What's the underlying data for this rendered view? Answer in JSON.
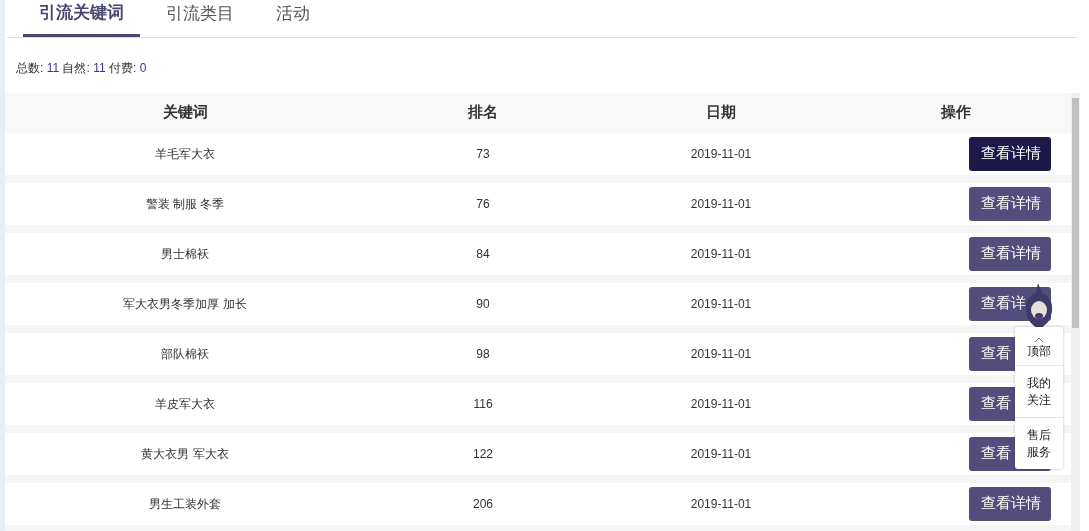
{
  "tabs": [
    {
      "label": "引流关键词",
      "selected": true
    },
    {
      "label": "引流类目",
      "selected": false
    },
    {
      "label": "活动",
      "selected": false
    }
  ],
  "summary": [
    {
      "label": "总数: ",
      "value": "11"
    },
    {
      "label": " 自然: ",
      "value": "11"
    },
    {
      "label": " 付费: ",
      "value": "0"
    }
  ],
  "table": {
    "columns": [
      "关键词",
      "排名",
      "日期",
      "操作"
    ],
    "rows": [
      {
        "keyword": "羊毛军大衣",
        "rank": "73",
        "date": "2019-11-01",
        "button": "查看详情",
        "selected": true
      },
      {
        "keyword": "警装 制服 冬季",
        "rank": "76",
        "date": "2019-11-01",
        "button": "查看详情",
        "selected": false
      },
      {
        "keyword": "男士棉袄",
        "rank": "84",
        "date": "2019-11-01",
        "button": "查看详情",
        "selected": false
      },
      {
        "keyword": "军大衣男冬季加厚 加长",
        "rank": "90",
        "date": "2019-11-01",
        "button": "查看详",
        "selected": false
      },
      {
        "keyword": "部队棉袄",
        "rank": "98",
        "date": "2019-11-01",
        "button": "查看",
        "selected": false
      },
      {
        "keyword": "羊皮军大衣",
        "rank": "116",
        "date": "2019-11-01",
        "button": "查看",
        "selected": false
      },
      {
        "keyword": "黄大衣男 军大衣",
        "rank": "122",
        "date": "2019-11-01",
        "button": "查看",
        "selected": false
      },
      {
        "keyword": "男生工装外套",
        "rank": "206",
        "date": "2019-11-01",
        "button": "查看详情",
        "selected": false
      }
    ]
  },
  "side_widget": {
    "items": [
      {
        "kind": "top",
        "label": "顶部"
      },
      {
        "kind": "text",
        "label": "我的关注"
      },
      {
        "kind": "text",
        "label": "售后服务"
      }
    ]
  }
}
